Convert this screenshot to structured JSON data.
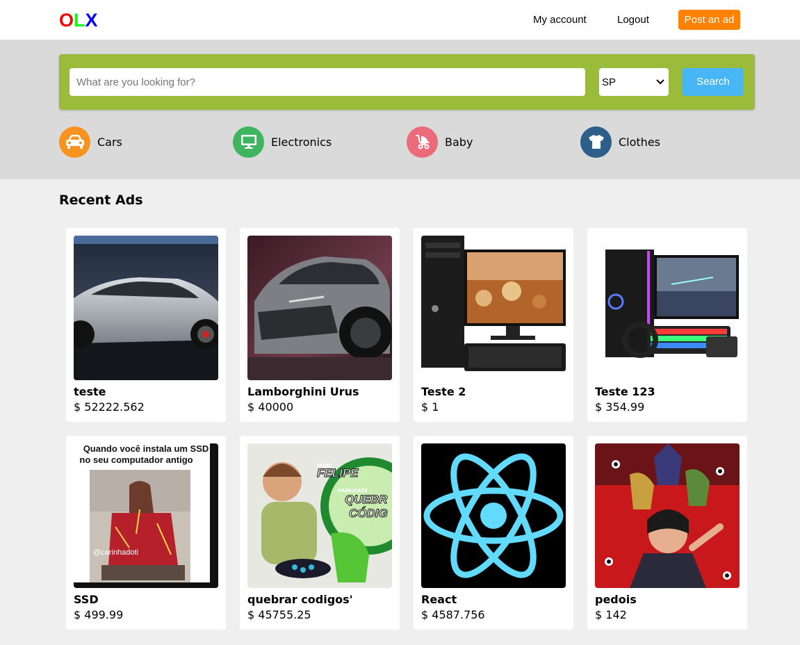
{
  "header": {
    "logo": {
      "o": "O",
      "l": "L",
      "x": "X"
    },
    "my_account": "My account",
    "logout": "Logout",
    "post_ad": "Post an ad"
  },
  "search": {
    "placeholder": "What are you looking for?",
    "state_selected": "SP",
    "button": "Search"
  },
  "categories": [
    {
      "label": "Cars",
      "icon": "car-icon",
      "color": "#f7931e"
    },
    {
      "label": "Electronics",
      "icon": "monitor-icon",
      "color": "#3eb55e"
    },
    {
      "label": "Baby",
      "icon": "stroller-icon",
      "color": "#ec6b7a"
    },
    {
      "label": "Clothes",
      "icon": "tshirt-icon",
      "color": "#2d5f8b"
    }
  ],
  "recent": {
    "title": "Recent Ads",
    "ads": [
      {
        "title": "teste",
        "price": "$ 52222.562"
      },
      {
        "title": "Lamborghini Urus",
        "price": "$ 40000"
      },
      {
        "title": "Teste 2",
        "price": "$ 1"
      },
      {
        "title": "Teste 123",
        "price": "$ 354.99"
      },
      {
        "title": "SSD",
        "price": "$ 499.99",
        "image_text": [
          "Quando você instala um SSD",
          "no seu computador antigo",
          "@carinhadoti"
        ]
      },
      {
        "title": "quebrar codigos'",
        "price": "$ 45755.25",
        "image_text": [
          "NOME",
          "FELIPE",
          "HABILIDADE",
          "QUEBR",
          "CÓDIG"
        ]
      },
      {
        "title": "React",
        "price": "$ 4587.756"
      },
      {
        "title": "pedois",
        "price": "$ 142"
      }
    ]
  },
  "colors": {
    "post_button": "#ff8100",
    "search_box": "#9bbb3a",
    "search_button": "#48b6f5"
  }
}
